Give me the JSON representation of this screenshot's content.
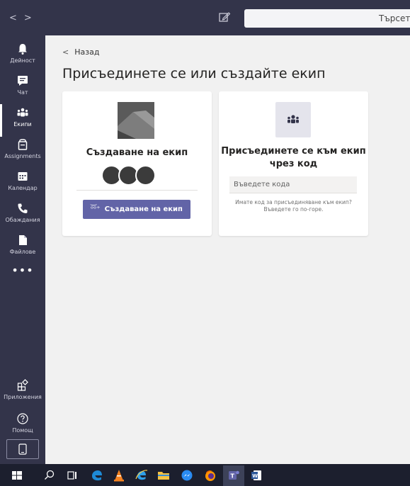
{
  "titlebar": {
    "back_arrow": "<",
    "forward_arrow": ">",
    "search_placeholder": "Търсете и"
  },
  "rail": {
    "items": [
      {
        "label": "Дейност",
        "icon": "bell-icon"
      },
      {
        "label": "Чат",
        "icon": "chat-icon"
      },
      {
        "label": "Екипи",
        "icon": "teams-icon",
        "active": true
      },
      {
        "label": "Assignments",
        "icon": "assignments-icon"
      },
      {
        "label": "Календар",
        "icon": "calendar-icon"
      },
      {
        "label": "Обаждания",
        "icon": "phone-icon"
      },
      {
        "label": "Файлове",
        "icon": "file-icon"
      }
    ],
    "more": "•••",
    "apps_label": "Приложения",
    "help_label": "Помощ"
  },
  "main": {
    "back_label": "Назад",
    "title": "Присъединете се или създайте екип",
    "create_card": {
      "heading": "Създаване на екип",
      "button_label": "Създаване на екип"
    },
    "join_card": {
      "heading": "Присъединете се към екип чрез код",
      "input_placeholder": "Въведете кода",
      "hint": "Имате код за присъединяване към екип? Въведете го по-горе."
    }
  },
  "taskbar": {
    "items": [
      "windows-start-icon",
      "search-icon",
      "task-view-icon",
      "edge-icon",
      "vlc-icon",
      "ie-icon",
      "file-explorer-icon",
      "messenger-icon",
      "firefox-icon",
      "teams-app-icon",
      "word-icon"
    ]
  },
  "colors": {
    "rail_bg": "#33344a",
    "accent": "#6264a7",
    "page_bg": "#f1f1f1",
    "taskbar_bg": "#1c1f2e"
  }
}
